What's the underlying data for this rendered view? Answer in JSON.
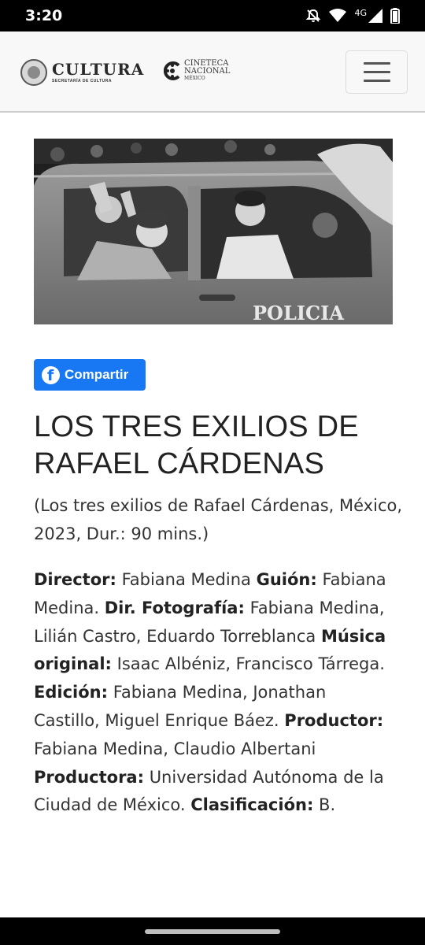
{
  "status_bar": {
    "time": "3:20",
    "network": "4G",
    "icons": [
      "mute-icon",
      "wifi-icon",
      "signal-icon",
      "battery-icon"
    ]
  },
  "header": {
    "cultura_name": "CULTURA",
    "cultura_sub": "SECRETARÍA DE CULTURA",
    "cineteca_line1": "CINETECA",
    "cineteca_line2": "NACIONAL",
    "cineteca_line3": "MÉXICO",
    "menu_icon": "hamburger-menu-icon"
  },
  "hero": {
    "car_lettering": "POLICIA"
  },
  "share": {
    "label": "Compartir",
    "color": "#1877f2"
  },
  "film": {
    "title": "LOS TRES EXILIOS DE RAFAEL CÁRDENAS",
    "subtitle": "(Los tres exilios de Rafael Cárdenas, México, 2023, Dur.: 90 mins.)"
  },
  "credits": {
    "director_label": "Director:",
    "director_value": "Fabiana Medina",
    "guion_label": "Guión:",
    "guion_value": "Fabiana Medina.",
    "foto_label": "Dir. Fotografía:",
    "foto_value": "Fabiana Medina, Lilián Castro, Eduardo Torreblanca",
    "musica_label": "Música original:",
    "musica_value": "Isaac Albéniz, Francisco Tárrega.",
    "edicion_label": "Edición:",
    "edicion_value": "Fabiana Medina, Jonathan Castillo, Miguel Enrique Báez.",
    "productor_label": "Productor:",
    "productor_value": "Fabiana Medina, Claudio Albertani",
    "productora_label": "Productora:",
    "productora_value": "Universidad Autónoma de la Ciudad de México.",
    "clasificacion_label": "Clasificación:",
    "clasificacion_value": "B."
  }
}
